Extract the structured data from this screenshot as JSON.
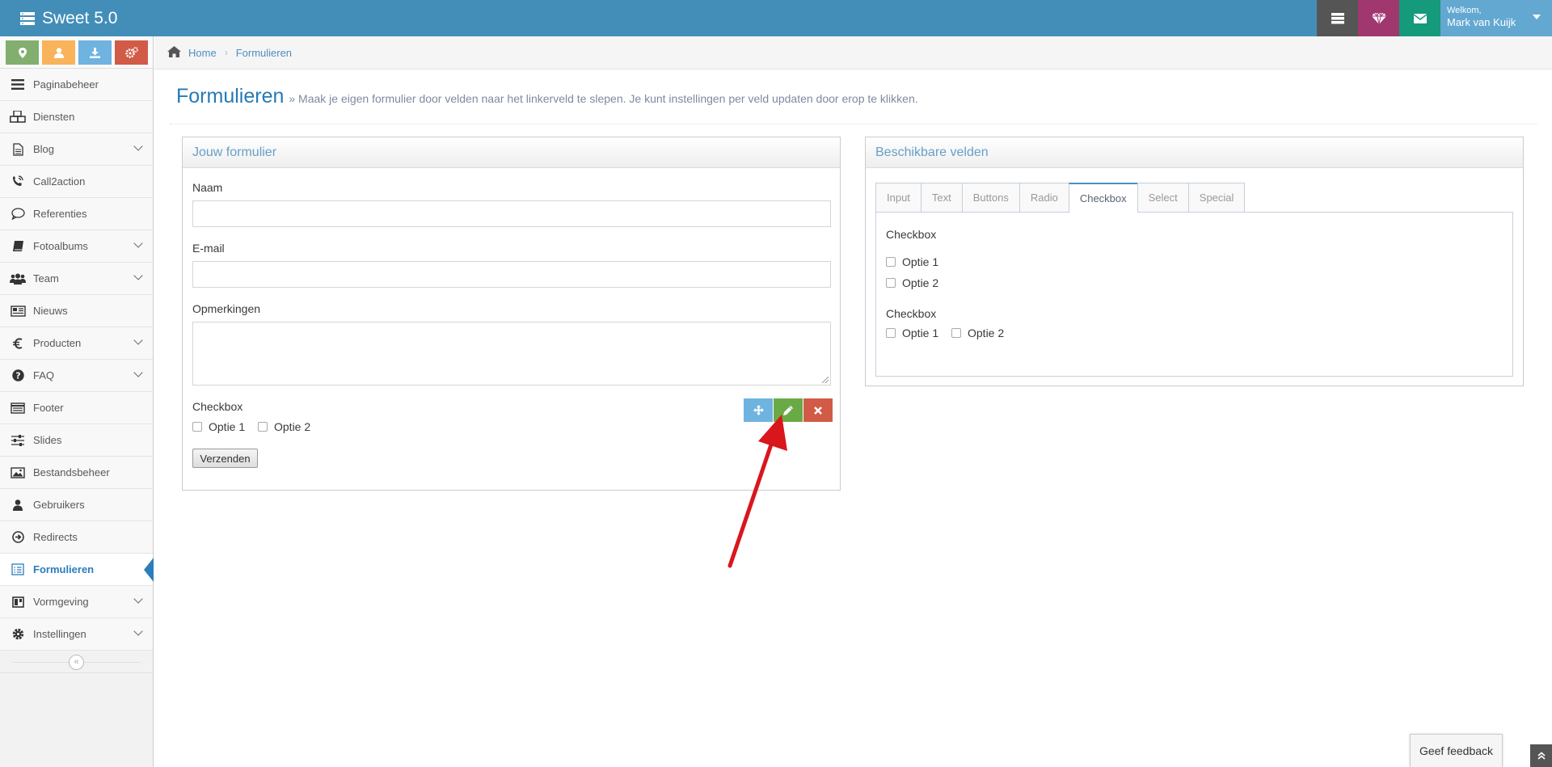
{
  "app": {
    "title": "Sweet 5.0"
  },
  "user": {
    "welcome": "Welkom,",
    "name": "Mark van Kuijk"
  },
  "sidebar": {
    "items": [
      {
        "label": "Paginabeheer"
      },
      {
        "label": "Diensten"
      },
      {
        "label": "Blog"
      },
      {
        "label": "Call2action"
      },
      {
        "label": "Referenties"
      },
      {
        "label": "Fotoalbums"
      },
      {
        "label": "Team"
      },
      {
        "label": "Nieuws"
      },
      {
        "label": "Producten"
      },
      {
        "label": "FAQ"
      },
      {
        "label": "Footer"
      },
      {
        "label": "Slides"
      },
      {
        "label": "Bestandsbeheer"
      },
      {
        "label": "Gebruikers"
      },
      {
        "label": "Redirects"
      },
      {
        "label": "Formulieren"
      },
      {
        "label": "Vormgeving"
      },
      {
        "label": "Instellingen"
      }
    ],
    "collapse_glyph": "«"
  },
  "breadcrumb": {
    "home": "Home",
    "current": "Formulieren"
  },
  "page": {
    "title": "Formulieren",
    "subtitle": "» Maak je eigen formulier door velden naar het linkerveld te slepen. Je kunt instellingen per veld updaten door erop te klikken."
  },
  "form_widget": {
    "title": "Jouw formulier",
    "fields": {
      "name_label": "Naam",
      "email_label": "E-mail",
      "remarks_label": "Opmerkingen",
      "checkbox_label": "Checkbox",
      "option1": "Optie 1",
      "option2": "Optie 2"
    },
    "submit_label": "Verzenden"
  },
  "fields_widget": {
    "title": "Beschikbare velden",
    "tabs": [
      {
        "label": "Input"
      },
      {
        "label": "Text"
      },
      {
        "label": "Buttons"
      },
      {
        "label": "Radio"
      },
      {
        "label": "Checkbox"
      },
      {
        "label": "Select"
      },
      {
        "label": "Special"
      }
    ],
    "active_tab": "Checkbox",
    "group1": {
      "label": "Checkbox",
      "option1": "Optie 1",
      "option2": "Optie 2"
    },
    "group2": {
      "label": "Checkbox",
      "option1": "Optie 1",
      "option2": "Optie 2"
    }
  },
  "feedback": {
    "label": "Geef feedback"
  },
  "colors": {
    "navbar": "#438eb9",
    "move_button": "#6fb3e0",
    "edit_button": "#69aa46",
    "delete_button": "#d15b47",
    "annotation_arrow": "#d9161c"
  }
}
